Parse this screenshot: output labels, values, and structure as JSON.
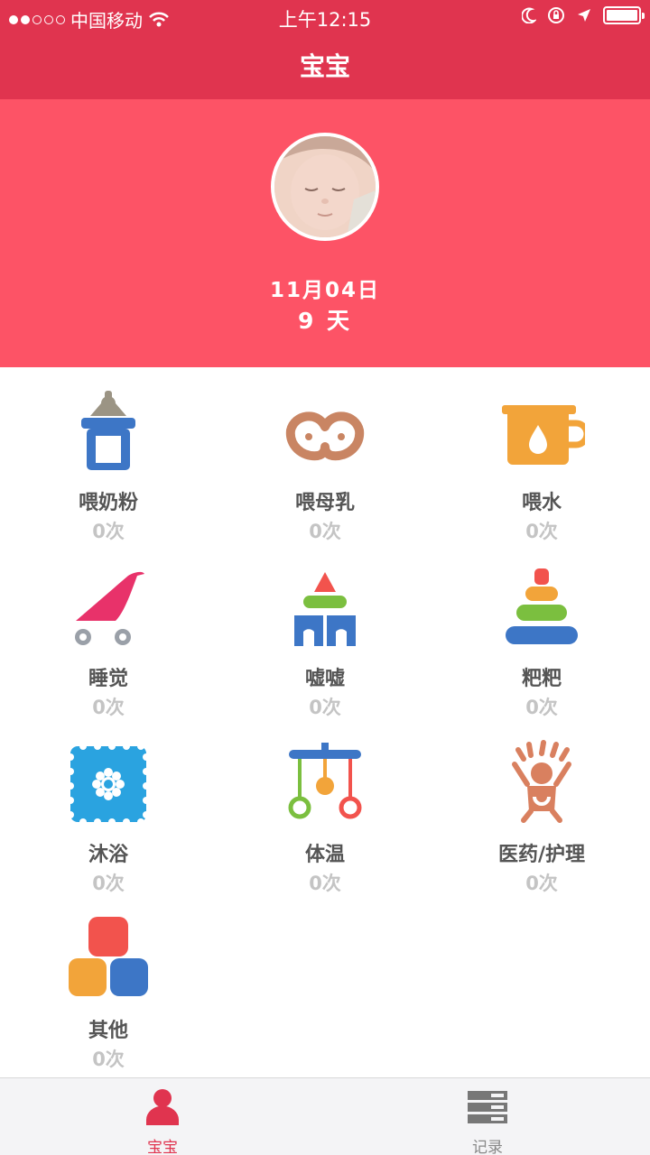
{
  "status_bar": {
    "carrier": "中国移动",
    "time": "上午12:15",
    "signal_dots_filled": 2,
    "signal_dots_total": 5,
    "icons": [
      "wifi-icon",
      "moon-icon",
      "rotation-lock-icon",
      "location-arrow-icon",
      "battery-icon"
    ]
  },
  "nav": {
    "title": "宝宝"
  },
  "profile": {
    "date": "11月04日",
    "age_days": "9 天"
  },
  "activities": [
    {
      "id": "formula",
      "label": "喂奶粉",
      "count": "0次",
      "icon": "baby-bottle-icon"
    },
    {
      "id": "breastfeed",
      "label": "喂母乳",
      "count": "0次",
      "icon": "breast-icon"
    },
    {
      "id": "water",
      "label": "喂水",
      "count": "0次",
      "icon": "cup-icon"
    },
    {
      "id": "sleep",
      "label": "睡觉",
      "count": "0次",
      "icon": "stroller-icon"
    },
    {
      "id": "pee",
      "label": "嘘嘘",
      "count": "0次",
      "icon": "blocks-icon"
    },
    {
      "id": "poop",
      "label": "粑粑",
      "count": "0次",
      "icon": "stacking-rings-icon"
    },
    {
      "id": "bath",
      "label": "沐浴",
      "count": "0次",
      "icon": "bath-towel-icon"
    },
    {
      "id": "temperature",
      "label": "体温",
      "count": "0次",
      "icon": "mobile-toy-icon"
    },
    {
      "id": "medicine",
      "label": "医药/护理",
      "count": "0次",
      "icon": "baby-figure-icon"
    },
    {
      "id": "other",
      "label": "其他",
      "count": "0次",
      "icon": "colored-squares-icon"
    }
  ],
  "tabs": [
    {
      "label": "宝宝",
      "icon": "person-icon",
      "active": true
    },
    {
      "label": "记录",
      "icon": "list-icon",
      "active": false
    }
  ],
  "colors": {
    "nav_bg": "#e0344f",
    "header_bg": "#fd5366",
    "label": "#555555",
    "count": "#c4c4c4",
    "active_tab": "#e0344f"
  }
}
